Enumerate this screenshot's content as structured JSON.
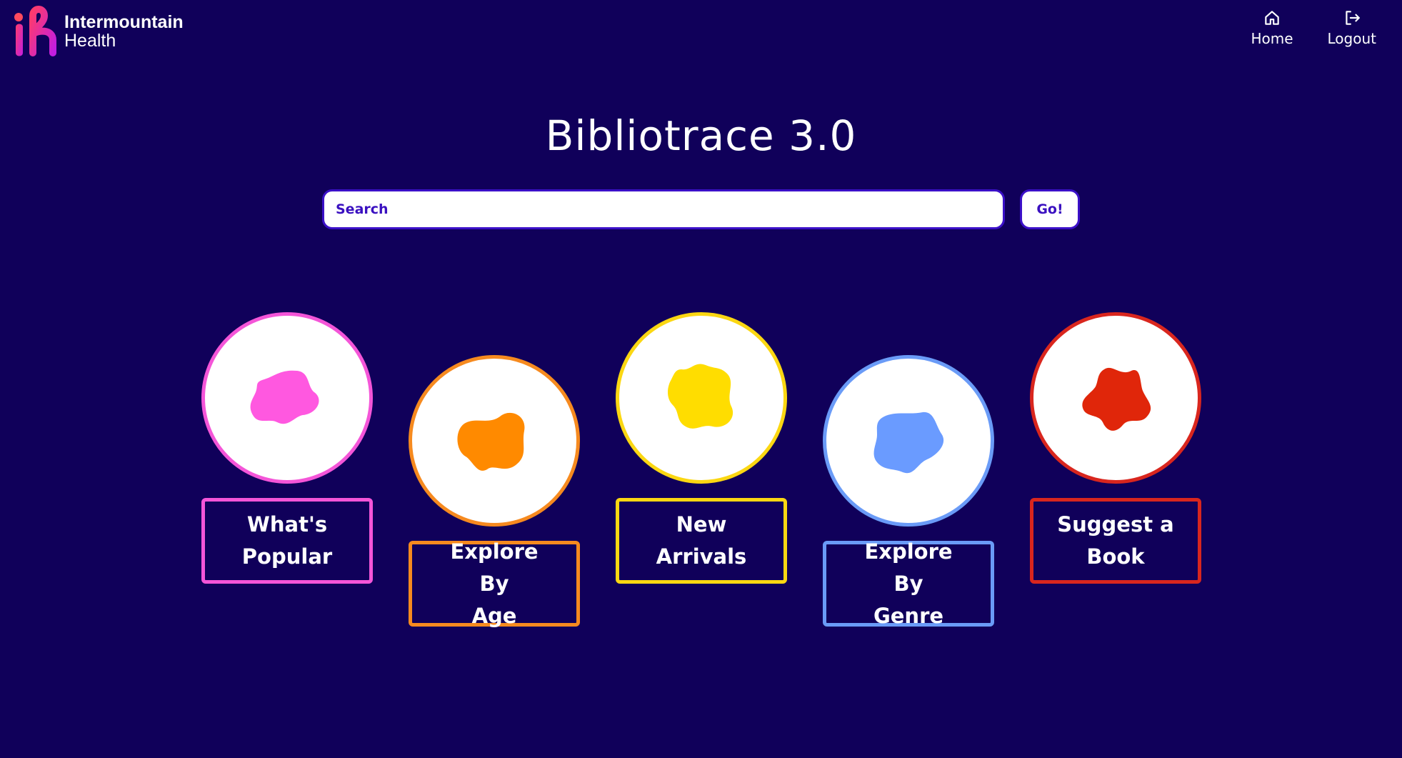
{
  "header": {
    "logo": {
      "line1": "Intermountain",
      "line2": "Health",
      "icon": "ih-logo-mark"
    },
    "nav": [
      {
        "label": "Home",
        "icon": "home-icon"
      },
      {
        "label": "Logout",
        "icon": "logout-icon"
      }
    ]
  },
  "main": {
    "title": "Bibliotrace 3.0",
    "search": {
      "placeholder": "Search",
      "button_label": "Go!"
    },
    "categories": [
      {
        "label_line1": "What's",
        "label_line2": "Popular",
        "color": "#f455d8",
        "icon": "pink-blob-icon"
      },
      {
        "label_line1": "Explore By",
        "label_line2": "Age",
        "color": "#f68a1f",
        "icon": "orange-blob-icon"
      },
      {
        "label_line1": "New",
        "label_line2": "Arrivals",
        "color": "#fbd712",
        "icon": "yellow-blob-icon"
      },
      {
        "label_line1": "Explore By",
        "label_line2": "Genre",
        "color": "#6a9bf7",
        "icon": "blue-blob-icon"
      },
      {
        "label_line1": "Suggest a",
        "label_line2": "Book",
        "color": "#d9261e",
        "icon": "red-blob-icon"
      }
    ]
  },
  "colors": {
    "background": "#10005a",
    "accent": "#3a10c0"
  }
}
